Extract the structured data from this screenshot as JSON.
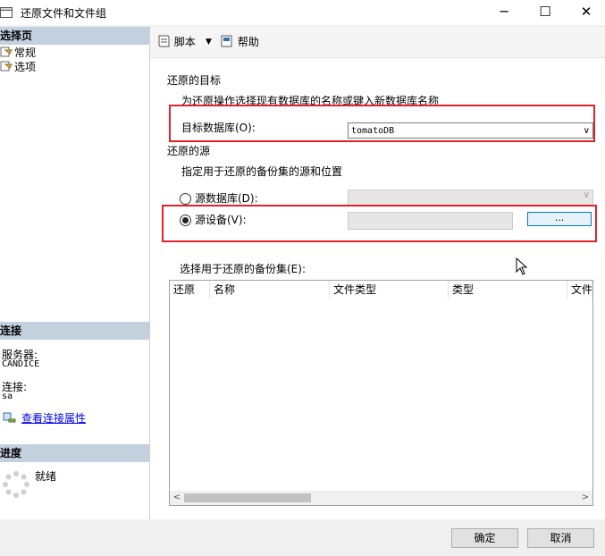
{
  "window": {
    "title": "还原文件和文件组",
    "min_glyph": "─",
    "max_glyph": "☐",
    "close_glyph": "✕"
  },
  "left": {
    "select_page_header": "选择页",
    "nav_items": [
      "常规",
      "选项"
    ],
    "connection_header": "连接",
    "server_label": "服务器:",
    "server_value": "CANDICE",
    "connection_label": "连接:",
    "connection_value": "sa",
    "view_connection_link": "查看连接属性",
    "progress_header": "进度",
    "progress_status": "就绪"
  },
  "toolbar": {
    "script_label": "脚本",
    "help_label": "帮助",
    "dropdown_glyph": "▼"
  },
  "restore_target": {
    "section_title": "还原的目标",
    "description": "为还原操作选择现有数据库的名称或键入新数据库名称",
    "target_db_label": "目标数据库(O):",
    "target_db_value": "tomatoDB"
  },
  "restore_source": {
    "section_title": "还原的源",
    "description": "指定用于还原的备份集的源和位置",
    "source_db_label": "源数据库(D):",
    "source_device_label": "源设备(V):",
    "source_device_value": "",
    "browse_button_label": "...",
    "selected_option": "source_device"
  },
  "backup_sets": {
    "label": "选择用于还原的备份集(E):",
    "columns": [
      "还原",
      "名称",
      "文件类型",
      "类型",
      "文件"
    ]
  },
  "footer": {
    "ok_label": "确定",
    "cancel_label": "取消"
  },
  "colors": {
    "highlight_box": "#e0232b",
    "section_header_bg": "#c3d1df",
    "link": "#0000ee"
  }
}
